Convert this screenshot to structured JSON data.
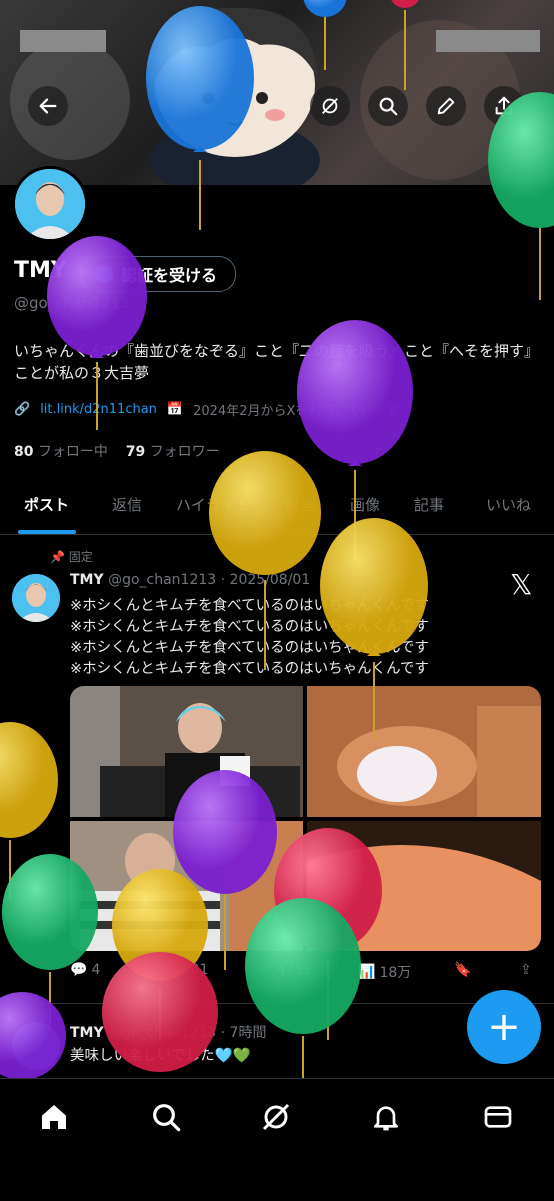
{
  "profile": {
    "name": "TMY",
    "verify_label": "認証を受ける",
    "handle": "@go_chan1213",
    "bio_line1": "いちゃんくんの『歯並びをなぞる』こと『二の腕を吸う』こと『へそを押す』",
    "bio_line2": "ことが私の３大吉夢",
    "link": "lit.link/d2n11chan",
    "joined": "2024年2月からXを利用しています",
    "following_count": "80",
    "following_label": "フォロー中",
    "followers_count": "79",
    "followers_label": "フォロワー"
  },
  "tabs": [
    "ポスト",
    "返信",
    "ハイライト",
    "動画",
    "画像",
    "記事",
    "いいね"
  ],
  "pinned_post": {
    "pinned_label": "固定",
    "name": "TMY",
    "handle_date": "@go_chan1213 · 2025/08/01",
    "lines": [
      "※ホシくんとキムチを食べているのはいちゃんくんです",
      "※ホシくんとキムチを食べているのはいちゃんくんです",
      "※ホシくんとキムチを食べているのはいちゃんくんです",
      "※ホシくんとキムチを食べているのはいちゃんくんです"
    ],
    "replies": "4",
    "reposts": "301",
    "likes": "4799",
    "views": "18万"
  },
  "second_post": {
    "name": "TMY",
    "handle_time": "@go_chan1213 · 7時間",
    "text": "美味しい楽しいでした🩵💚"
  },
  "colors": {
    "accent": "#1d9bf0",
    "balloon_purple": "#8a2be2",
    "balloon_yellow": "#e8c31a",
    "balloon_green": "#22c47a",
    "balloon_blue": "#2b8ff0",
    "balloon_red": "#e8365d"
  },
  "icons": [
    "back-arrow-icon",
    "grok-icon",
    "search-icon",
    "edit-icon",
    "share-icon",
    "home-icon",
    "explore-icon",
    "notifications-icon",
    "messages-icon"
  ]
}
